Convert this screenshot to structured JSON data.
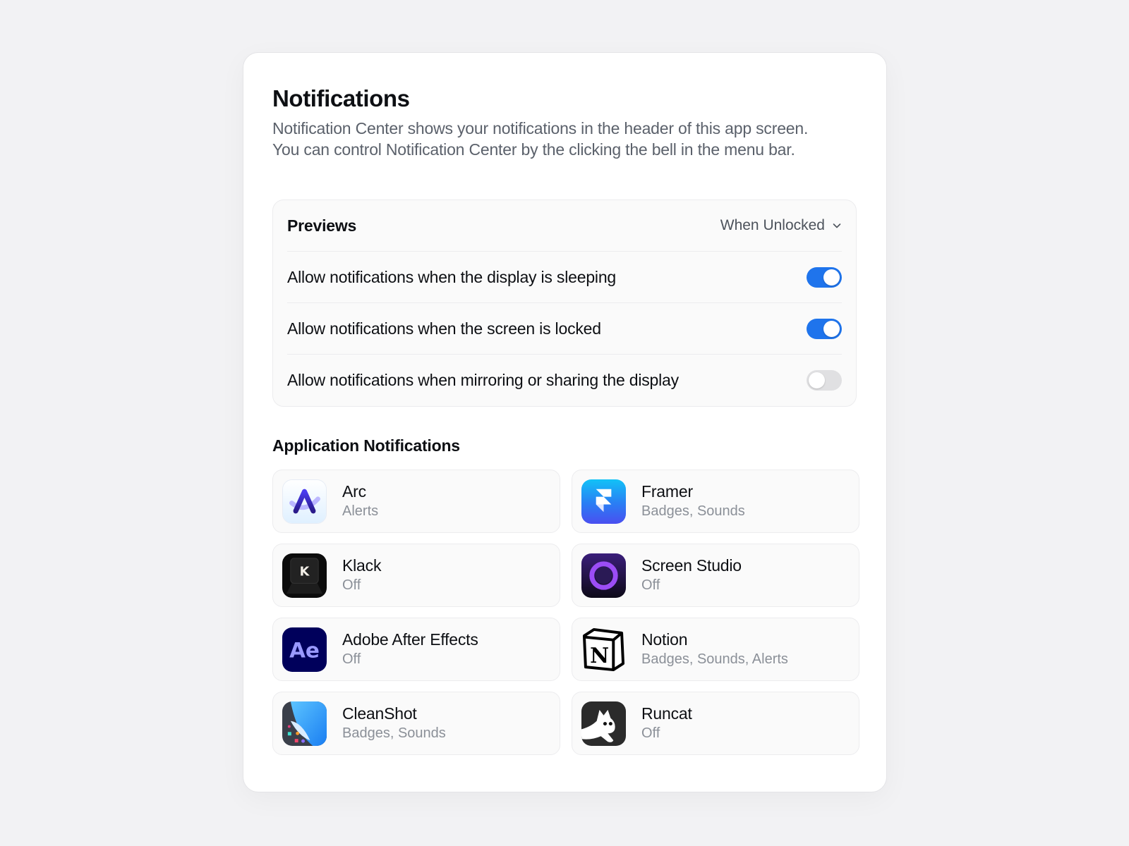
{
  "header": {
    "title": "Notifications",
    "description_line1": "Notification Center shows your notifications in the header of this app screen.",
    "description_line2": "You can control Notification Center by the clicking the bell in the menu bar."
  },
  "previews": {
    "label": "Previews",
    "selected_option": "When Unlocked",
    "settings": [
      {
        "label": "Allow notifications when the display is sleeping",
        "enabled": true
      },
      {
        "label": "Allow notifications when the screen is locked",
        "enabled": true
      },
      {
        "label": "Allow notifications when mirroring or sharing the display",
        "enabled": false
      }
    ]
  },
  "app_notifications": {
    "title": "Application Notifications",
    "apps": [
      {
        "name": "Arc",
        "status": "Alerts",
        "icon": "arc-icon"
      },
      {
        "name": "Framer",
        "status": "Badges, Sounds",
        "icon": "framer-icon"
      },
      {
        "name": "Klack",
        "status": "Off",
        "icon": "klack-icon"
      },
      {
        "name": "Screen Studio",
        "status": "Off",
        "icon": "screen-studio-icon"
      },
      {
        "name": "Adobe After Effects",
        "status": "Off",
        "icon": "after-effects-icon"
      },
      {
        "name": "Notion",
        "status": "Badges, Sounds, Alerts",
        "icon": "notion-icon"
      },
      {
        "name": "CleanShot",
        "status": "Badges, Sounds",
        "icon": "cleanshot-icon"
      },
      {
        "name": "Runcat",
        "status": "Off",
        "icon": "runcat-icon"
      }
    ]
  },
  "colors": {
    "toggle_on": "#1f74ec",
    "toggle_off": "#e0e0e2",
    "secondary_text": "#8b9098"
  }
}
